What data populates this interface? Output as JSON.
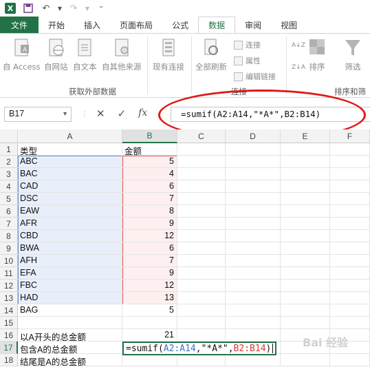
{
  "qat": {
    "logo": "X",
    "undo_icon": "undo-icon",
    "redo_icon": "redo-icon"
  },
  "tabs": [
    {
      "label": "文件"
    },
    {
      "label": "开始"
    },
    {
      "label": "插入"
    },
    {
      "label": "页面布局"
    },
    {
      "label": "公式"
    },
    {
      "label": "数据"
    },
    {
      "label": "审阅"
    },
    {
      "label": "视图"
    }
  ],
  "ribbon": {
    "from_access": "自 Access",
    "from_web": "自网站",
    "from_text": "自文本",
    "from_other": "自其他来源",
    "existing_conn": "现有连接",
    "refresh_all": "全部刷新",
    "connections": "连接",
    "properties": "属性",
    "edit_links": "编辑链接",
    "sort": "排序",
    "filter": "筛选",
    "group_external": "获取外部数据",
    "group_conn": "连接",
    "group_sort": "排序和筛选"
  },
  "formula_bar": {
    "name_box": "B17",
    "formula": "=sumif(A2:A14,\"*A*\",B2:B14)"
  },
  "columns": [
    "A",
    "B",
    "C",
    "D",
    "E",
    "F"
  ],
  "rows": [
    {
      "n": "1",
      "a": "类型",
      "b": "金额"
    },
    {
      "n": "2",
      "a": "ABC",
      "b": "5"
    },
    {
      "n": "3",
      "a": "BAC",
      "b": "4"
    },
    {
      "n": "4",
      "a": "CAD",
      "b": "6"
    },
    {
      "n": "5",
      "a": "DSC",
      "b": "7"
    },
    {
      "n": "6",
      "a": "EAW",
      "b": "8"
    },
    {
      "n": "7",
      "a": "AFR",
      "b": "9"
    },
    {
      "n": "8",
      "a": "CBD",
      "b": "12"
    },
    {
      "n": "9",
      "a": "BWA",
      "b": "6"
    },
    {
      "n": "10",
      "a": "AFH",
      "b": "7"
    },
    {
      "n": "11",
      "a": "EFA",
      "b": "9"
    },
    {
      "n": "12",
      "a": "FBC",
      "b": "12"
    },
    {
      "n": "13",
      "a": "HAD",
      "b": "13"
    },
    {
      "n": "14",
      "a": "BAG",
      "b": "5"
    },
    {
      "n": "15",
      "a": "",
      "b": ""
    },
    {
      "n": "16",
      "a": "以A开头的总金额",
      "b": "21"
    },
    {
      "n": "17",
      "a": "包含A的总金额",
      "b": ""
    },
    {
      "n": "18",
      "a": "结尾是A的总金额",
      "b": ""
    }
  ],
  "edit": {
    "prefix": "=sumif(",
    "ref_a": "A2:A14",
    "mid": ",\"*A*\",",
    "ref_b": "B2:B14",
    "suffix": ")"
  },
  "watermark": "Bai 经验"
}
